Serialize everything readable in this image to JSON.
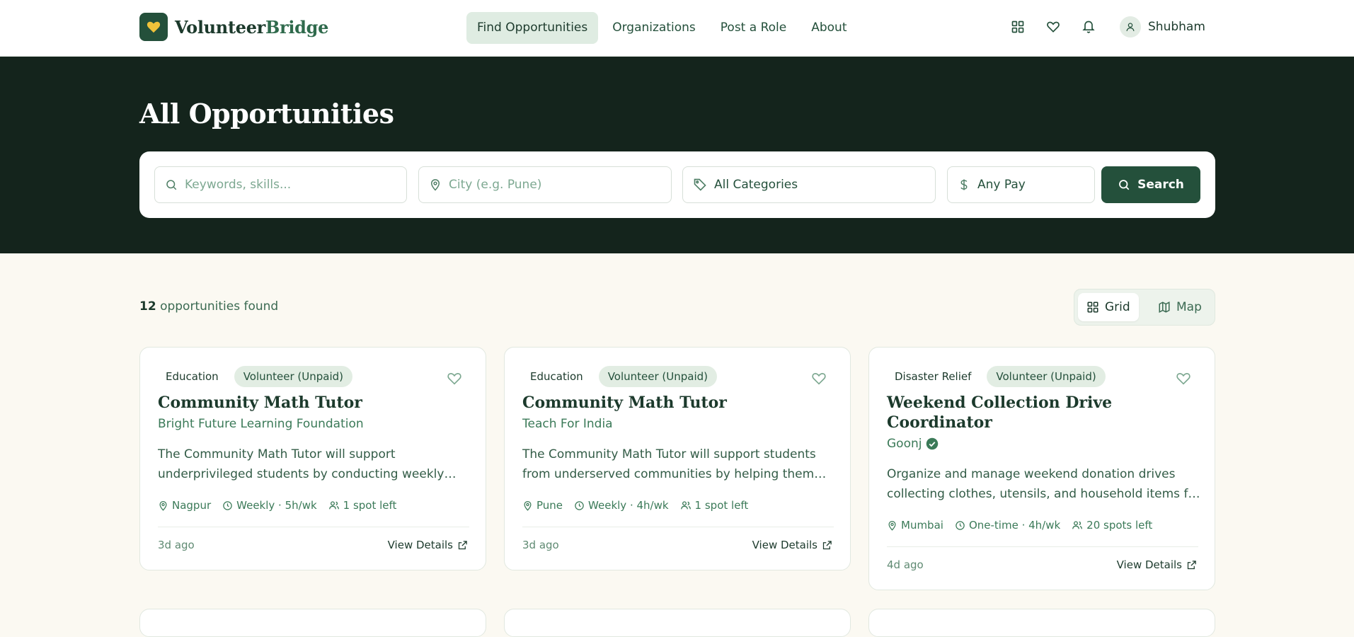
{
  "brand": {
    "name_part1": "Volunteer",
    "name_part2": "Bridge"
  },
  "nav": [
    {
      "label": "Find Opportunities",
      "active": true
    },
    {
      "label": "Organizations",
      "active": false
    },
    {
      "label": "Post a Role",
      "active": false
    },
    {
      "label": "About",
      "active": false
    }
  ],
  "header_icons": [
    "dashboard-grid-icon",
    "heart-icon",
    "bell-icon"
  ],
  "user": {
    "name": "Shubham"
  },
  "hero": {
    "title": "All Opportunities"
  },
  "search": {
    "keywords_placeholder": "Keywords, skills...",
    "city_placeholder": "City (e.g. Pune)",
    "category_value": "All Categories",
    "pay_value": "Any Pay",
    "button_label": "Search"
  },
  "results": {
    "count": "12",
    "count_suffix": "opportunities found"
  },
  "view_toggle": {
    "grid_label": "Grid",
    "map_label": "Map",
    "selected": "Grid"
  },
  "cards": [
    {
      "category": "Education",
      "type": "Volunteer (Unpaid)",
      "title": "Community Math Tutor",
      "org": "Bright Future Learning Foundation",
      "verified": false,
      "description": "The Community Math Tutor will support underprivileged students by conducting weekly math sessions.",
      "location": "Nagpur",
      "schedule": "Weekly · 5h/wk",
      "spots": "1 spot left",
      "posted": "3d ago",
      "action": "View Details"
    },
    {
      "category": "Education",
      "type": "Volunteer (Unpaid)",
      "title": "Community Math Tutor",
      "org": "Teach For India",
      "verified": false,
      "description": "The Community Math Tutor will support students from underserved communities by helping them strengthen their skills.",
      "location": "Pune",
      "schedule": "Weekly · 4h/wk",
      "spots": "1 spot left",
      "posted": "3d ago",
      "action": "View Details"
    },
    {
      "category": "Disaster Relief",
      "type": "Volunteer (Unpaid)",
      "title": "Weekend Collection Drive Coordinator",
      "org": "Goonj",
      "verified": true,
      "description": "Organize and manage weekend donation drives collecting clothes, utensils, and household items for communities in need.",
      "location": "Mumbai",
      "schedule": "One-time · 4h/wk",
      "spots": "20 spots left",
      "posted": "4d ago",
      "action": "View Details"
    }
  ],
  "colors": {
    "primary": "#24503b",
    "hero_bg": "#14241c",
    "page_bg": "#fbf9f2",
    "chip_bg": "#e2ede3",
    "logo_heart": "#f0c23a"
  }
}
